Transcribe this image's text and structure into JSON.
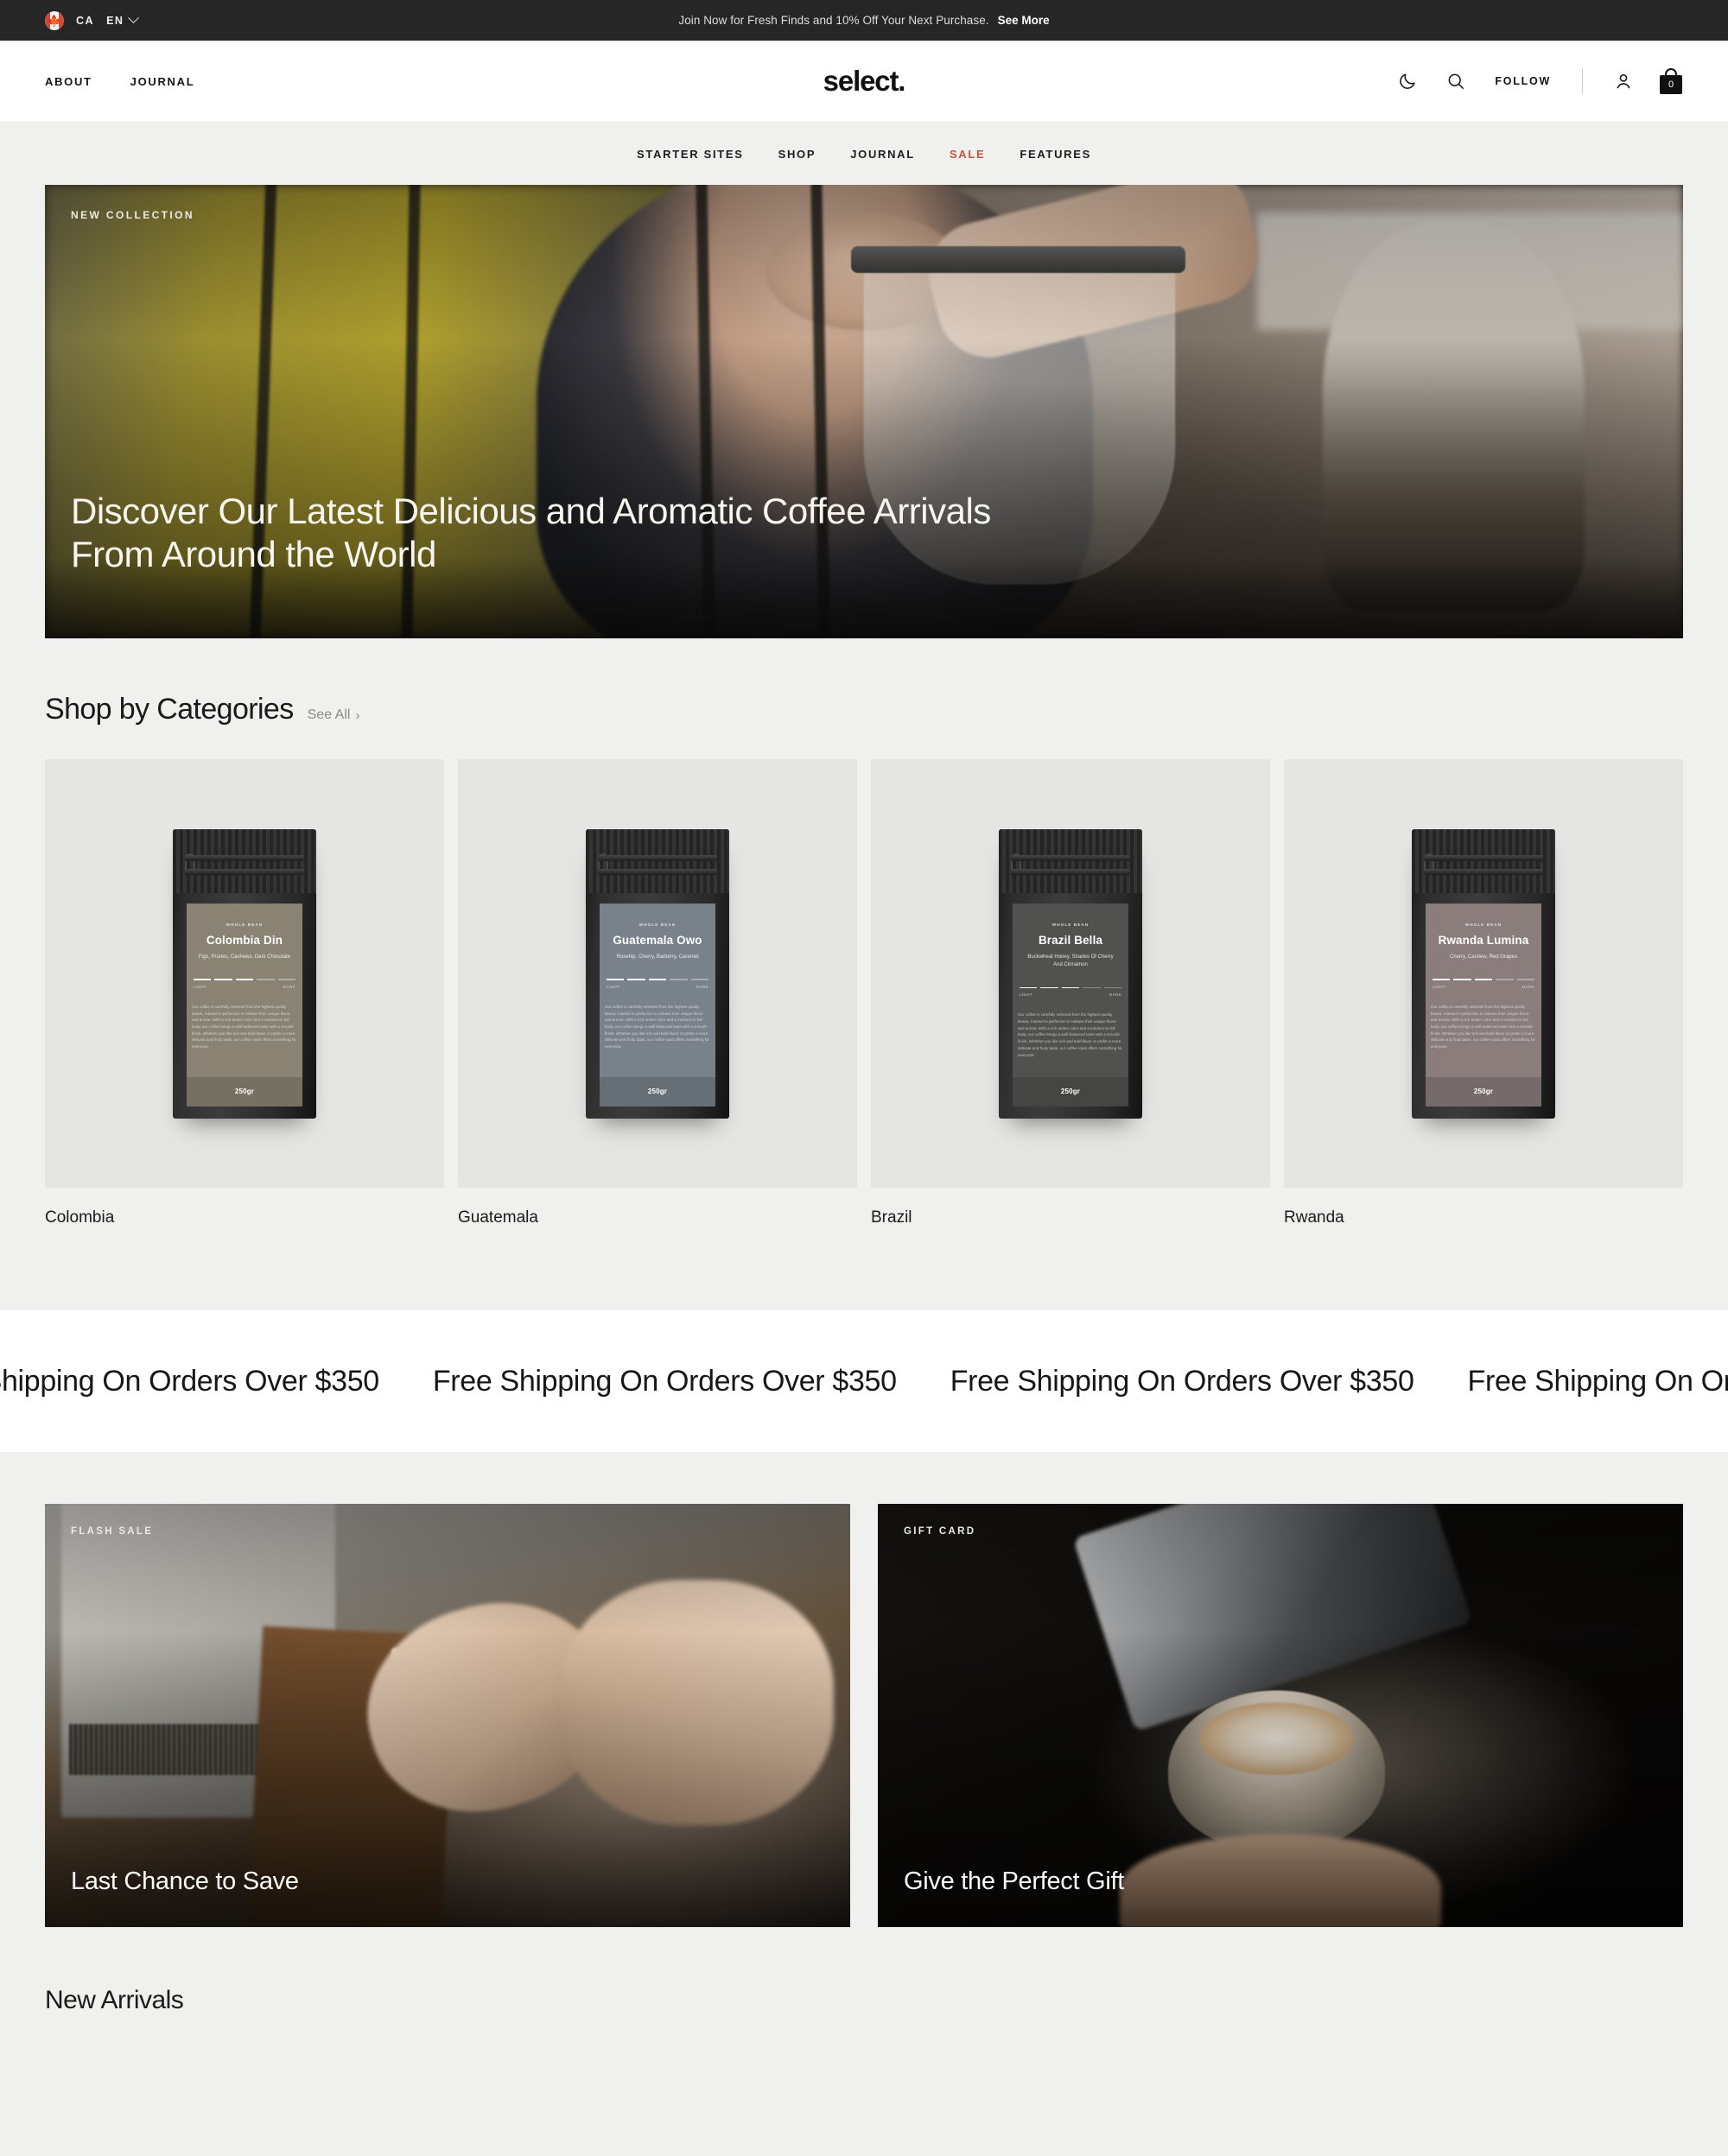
{
  "announcement": {
    "country_code": "CA",
    "language_code": "EN",
    "flag_icon": "canada-flag-icon",
    "message": "Join Now for Fresh Finds and 10% Off Your Next Purchase.",
    "link_label": "See More"
  },
  "header": {
    "left_links": [
      {
        "label": "About"
      },
      {
        "label": "Journal"
      }
    ],
    "logo": "select.",
    "right": {
      "theme_toggle_icon": "moon-icon",
      "search_icon": "search-icon",
      "follow_label": "Follow",
      "account_icon": "user-icon",
      "cart_icon": "shopping-bag-icon",
      "cart_count": "0"
    }
  },
  "subnav": {
    "items": [
      {
        "label": "Starter Sites",
        "highlight": false
      },
      {
        "label": "Shop",
        "highlight": false
      },
      {
        "label": "Journal",
        "highlight": false
      },
      {
        "label": "Sale",
        "highlight": true
      },
      {
        "label": "Features",
        "highlight": false
      }
    ],
    "sale_color": "#c2553f"
  },
  "hero": {
    "eyebrow": "New Collection",
    "title": "Discover Our Latest Delicious and Aromatic Coffee Arrivals From Around the World"
  },
  "categories_section": {
    "title": "Shop by Categories",
    "see_all_label": "See All",
    "see_all_arrow": "chevron-right-icon",
    "items": [
      {
        "name": "Colombia",
        "bag": {
          "whole_bean": "Whole Bean",
          "product_name": "Colombia Din",
          "notes": "Figs, Prunes, Cashews, Dark Chocolate",
          "scale_light": "Light",
          "scale_dark": "Dark",
          "blurb": "Our coffee is carefully selected from the highest quality beans, roasted to perfection to release their unique flavor and aroma. With a rich amber color and a medium-to-full body, our coffee brings a well-balanced taste with a smooth finish. Whether you like rich and bold flavor or prefer a more delicate and fruity taste, our coffee roast offers something for everyone.",
          "weight": "250gr",
          "label_color": "#8a8374"
        }
      },
      {
        "name": "Guatemala",
        "bag": {
          "whole_bean": "Whole Bean",
          "product_name": "Guatemala Owo",
          "notes": "Rosehip, Cherry, Barberry, Caramel",
          "scale_light": "Light",
          "scale_dark": "Dark",
          "blurb": "Our coffee is carefully selected from the highest quality beans, roasted to perfection to release their unique flavor and aroma. With a rich amber color and a medium-to-full body, our coffee brings a well-balanced taste with a smooth finish. Whether you like rich and bold flavor or prefer a more delicate and fruity taste, our coffee roast offers something for everyone.",
          "weight": "250gr",
          "label_color": "#79828a"
        }
      },
      {
        "name": "Brazil",
        "bag": {
          "whole_bean": "Whole Bean",
          "product_name": "Brazil Bella",
          "notes": "Buckwheat Honey, Shades Of Cherry And Cinnamon",
          "scale_light": "Light",
          "scale_dark": "Dark",
          "blurb": "Our coffee is carefully selected from the highest quality beans, roasted to perfection to release their unique flavor and aroma. With a rich amber color and a medium-to-full body, our coffee brings a well-balanced taste with a smooth finish. Whether you like rich and bold flavor or prefer a more delicate and fruity taste, our coffee roast offers something for everyone.",
          "weight": "250gr",
          "label_color": "#51514f"
        }
      },
      {
        "name": "Rwanda",
        "bag": {
          "whole_bean": "Whole Bean",
          "product_name": "Rwanda Lumina",
          "notes": "Cherry, Cashew, Red Grapes",
          "scale_light": "Light",
          "scale_dark": "Dark",
          "blurb": "Our coffee is carefully selected from the highest quality beans, roasted to perfection to release their unique flavor and aroma. With a rich amber color and a medium-to-full body, our coffee brings a well-balanced taste with a smooth finish. Whether you like rich and bold flavor or prefer a more delicate and fruity taste, our coffee roast offers something for everyone.",
          "weight": "250gr",
          "label_color": "#8a7d7c"
        }
      }
    ]
  },
  "marquee": {
    "text": "Free Shipping On Orders Over $350",
    "repeats": 6
  },
  "promos": [
    {
      "eyebrow": "Flash Sale",
      "title": "Last Chance to Save"
    },
    {
      "eyebrow": "Gift Card",
      "title": "Give the Perfect Gift"
    }
  ],
  "arrivals_section": {
    "title": "New Arrivals"
  }
}
